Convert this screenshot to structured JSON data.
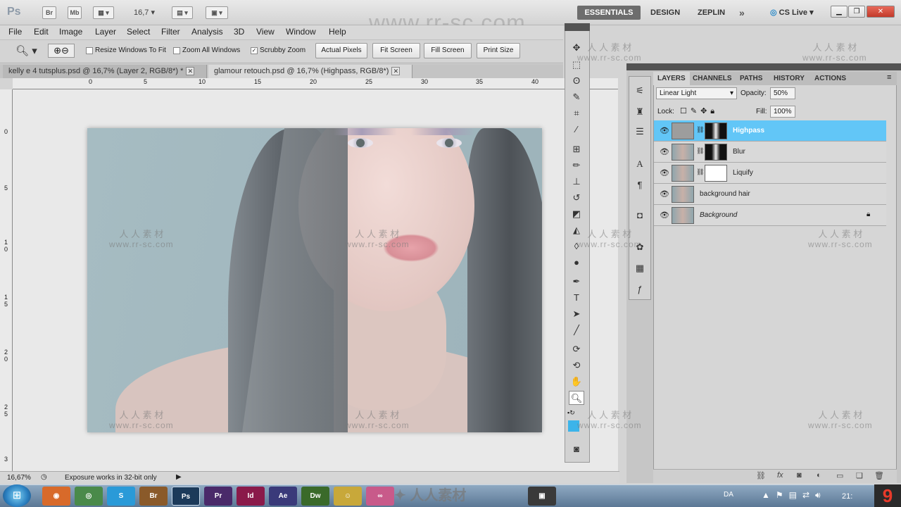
{
  "app": {
    "logo": "Ps",
    "bridge": "Br",
    "minibridge": "Mb",
    "zoom": "16,7",
    "workspaces": [
      "ESSENTIALS",
      "DESIGN",
      "ZEPLIN"
    ],
    "cs_live": "CS Live"
  },
  "menu": [
    "File",
    "Edit",
    "Image",
    "Layer",
    "Select",
    "Filter",
    "Analysis",
    "3D",
    "View",
    "Window",
    "Help"
  ],
  "options": {
    "resize_windows": "Resize Windows To Fit",
    "zoom_all": "Zoom All Windows",
    "scrubby_zoom": "Scrubby Zoom",
    "actual_pixels": "Actual Pixels",
    "fit_screen": "Fit Screen",
    "fill_screen": "Fill Screen",
    "print_size": "Print Size"
  },
  "tabs": [
    {
      "label": "kelly e 4 tutsplus.psd @ 16,7% (Layer 2, RGB/8*) *"
    },
    {
      "label": "glamour retouch.psd @ 16,7% (Highpass, RGB/8*)"
    }
  ],
  "ruler_h": [
    "0",
    "5",
    "10",
    "15",
    "20",
    "25",
    "30",
    "35",
    "40"
  ],
  "ruler_v": [
    "0",
    "5",
    "1 0",
    "1 5",
    "2 0",
    "2 5",
    "3"
  ],
  "status": {
    "zoom": "16,67%",
    "info": "Exposure works in 32-bit only"
  },
  "layers_panel": {
    "tabs": [
      "LAYERS",
      "CHANNELS",
      "PATHS",
      "HISTORY",
      "ACTIONS"
    ],
    "blend_mode": "Linear Light",
    "opacity_label": "Opacity:",
    "opacity": "50%",
    "lock_label": "Lock:",
    "fill_label": "Fill:",
    "fill": "100%",
    "layers": [
      {
        "name": "Highpass",
        "selected": true
      },
      {
        "name": "Blur",
        "selected": false
      },
      {
        "name": "Liquify",
        "selected": false
      },
      {
        "name": "background hair",
        "selected": false
      },
      {
        "name": "Background",
        "selected": false
      }
    ]
  },
  "taskbar": {
    "apps": [
      "Br",
      "Ps",
      "Pr",
      "Id",
      "Ae",
      "Dw"
    ],
    "lang": "DA",
    "clock": "21:",
    "badge": "9"
  },
  "watermark": {
    "top": "www.rr-sc.com",
    "cn": "人 人 素 材",
    "url": "www.rr-sc.com",
    "center_logo": "人人素材"
  },
  "colors": {
    "selected_layer": "#62c6f7",
    "foreground_swatch": "#3cb4ea",
    "active_workspace": "#6d6d6d"
  }
}
